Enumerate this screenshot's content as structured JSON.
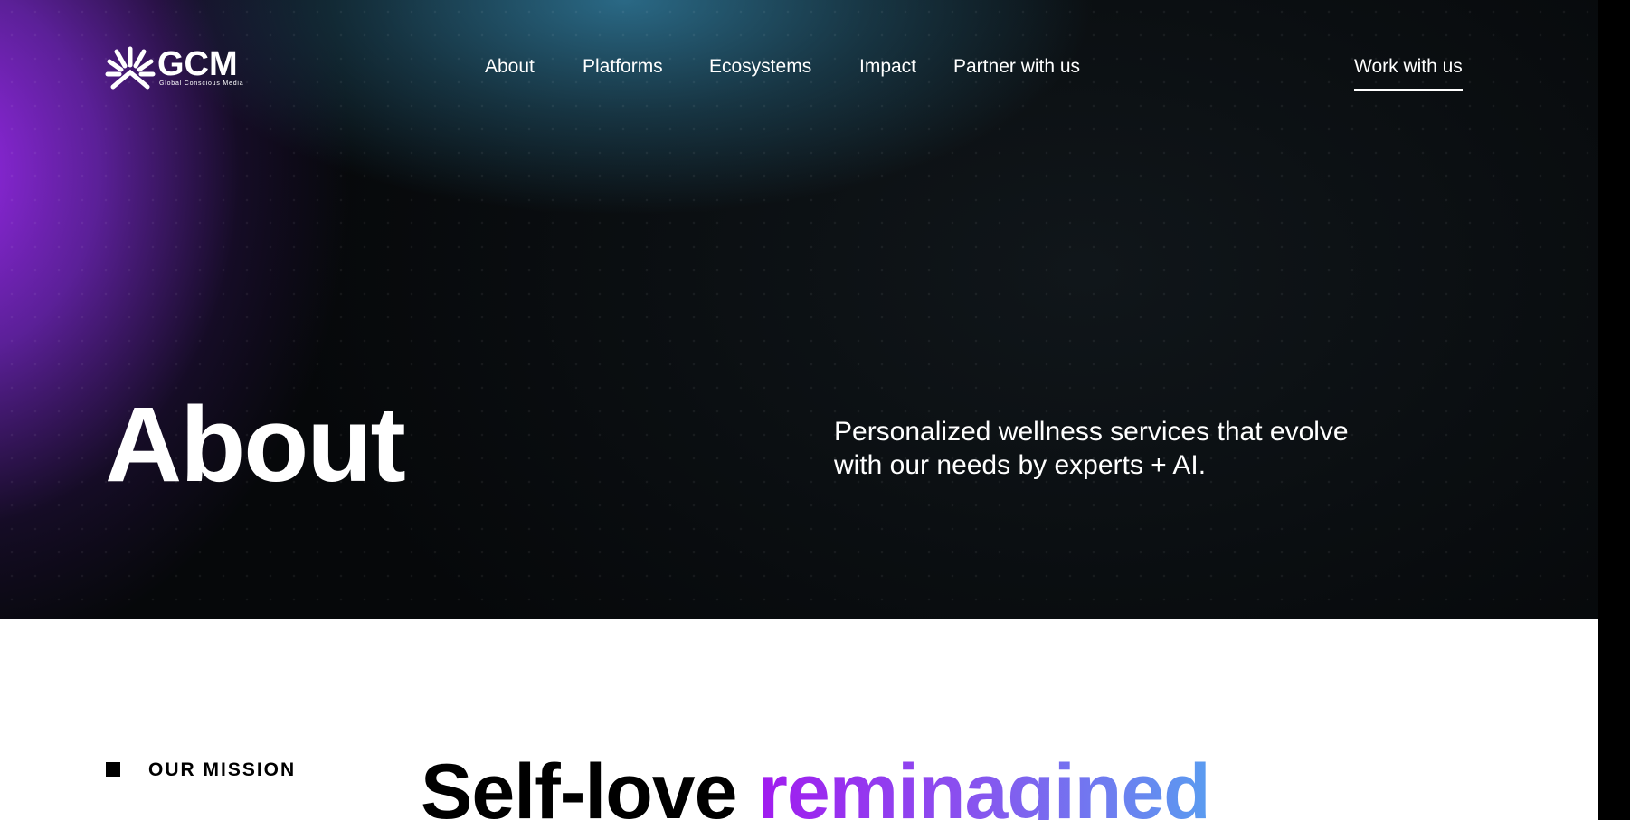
{
  "brand": {
    "name": "GCM",
    "tagline": "Global Conscious Media"
  },
  "nav": {
    "items": [
      {
        "label": "About"
      },
      {
        "label": "Platforms"
      },
      {
        "label": "Ecosystems"
      },
      {
        "label": "Impact"
      },
      {
        "label": "Partner with us"
      }
    ],
    "cta_label": "Work with us"
  },
  "hero": {
    "title": "About",
    "subtitle": "Personalized wellness services that evolve with our needs by experts + AI."
  },
  "mission": {
    "label": "OUR MISSION",
    "heading_plain": "Self-love",
    "heading_accent": "reminagined"
  },
  "colors": {
    "hero_purple": "#9b2ae8",
    "hero_teal": "#2c6e8c",
    "hero_dark": "#050507",
    "accent_gradient_start": "#a11bef",
    "accent_gradient_end": "#5a9cf0",
    "text_light": "#ffffff",
    "text_dark": "#000000"
  },
  "icons": {
    "logo_mark": "sunburst-logo-icon"
  }
}
